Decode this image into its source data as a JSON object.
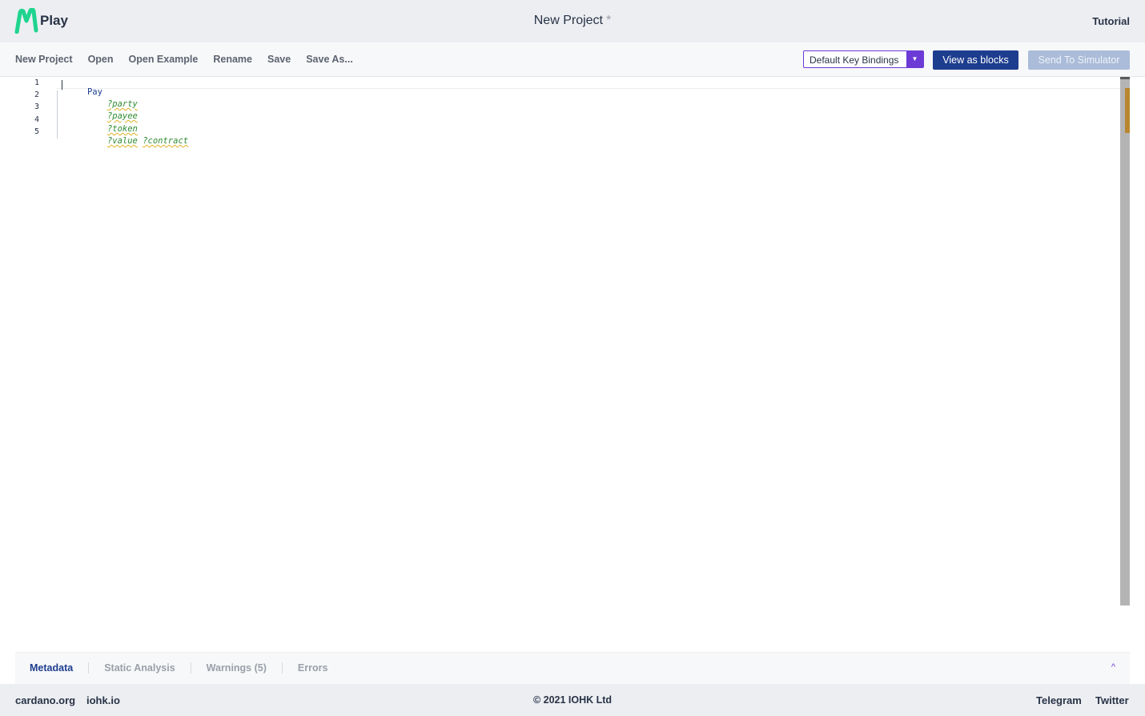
{
  "header": {
    "logo_text": "Play",
    "project_title": "New Project",
    "modified_mark": "*",
    "tutorial_label": "Tutorial"
  },
  "toolbar": {
    "menu": [
      "New Project",
      "Open",
      "Open Example",
      "Rename",
      "Save",
      "Save As..."
    ],
    "key_bindings_selected": "Default Key Bindings",
    "view_as_blocks_label": "View as blocks",
    "send_to_simulator_label": "Send To Simulator"
  },
  "editor": {
    "line_numbers": [
      "1",
      "2",
      "3",
      "4",
      "5"
    ],
    "line1_keyword": "Pay",
    "hole_party": "?party",
    "hole_payee": "?payee",
    "hole_token": "?token",
    "hole_value": "?value",
    "hole_contract": "?contract"
  },
  "panel": {
    "tabs": [
      "Metadata",
      "Static Analysis",
      "Warnings (5)",
      "Errors"
    ],
    "collapse_glyph": "^"
  },
  "footer": {
    "left_links": [
      "cardano.org",
      "iohk.io"
    ],
    "copyright": "© 2021 IOHK Ltd",
    "right_links": [
      "Telegram",
      "Twitter"
    ]
  },
  "colors": {
    "accent_navy": "#1d3d8f",
    "accent_purple": "#6c3bd6",
    "logo_green": "#1fd48e",
    "hole_green": "#2e8b30"
  }
}
